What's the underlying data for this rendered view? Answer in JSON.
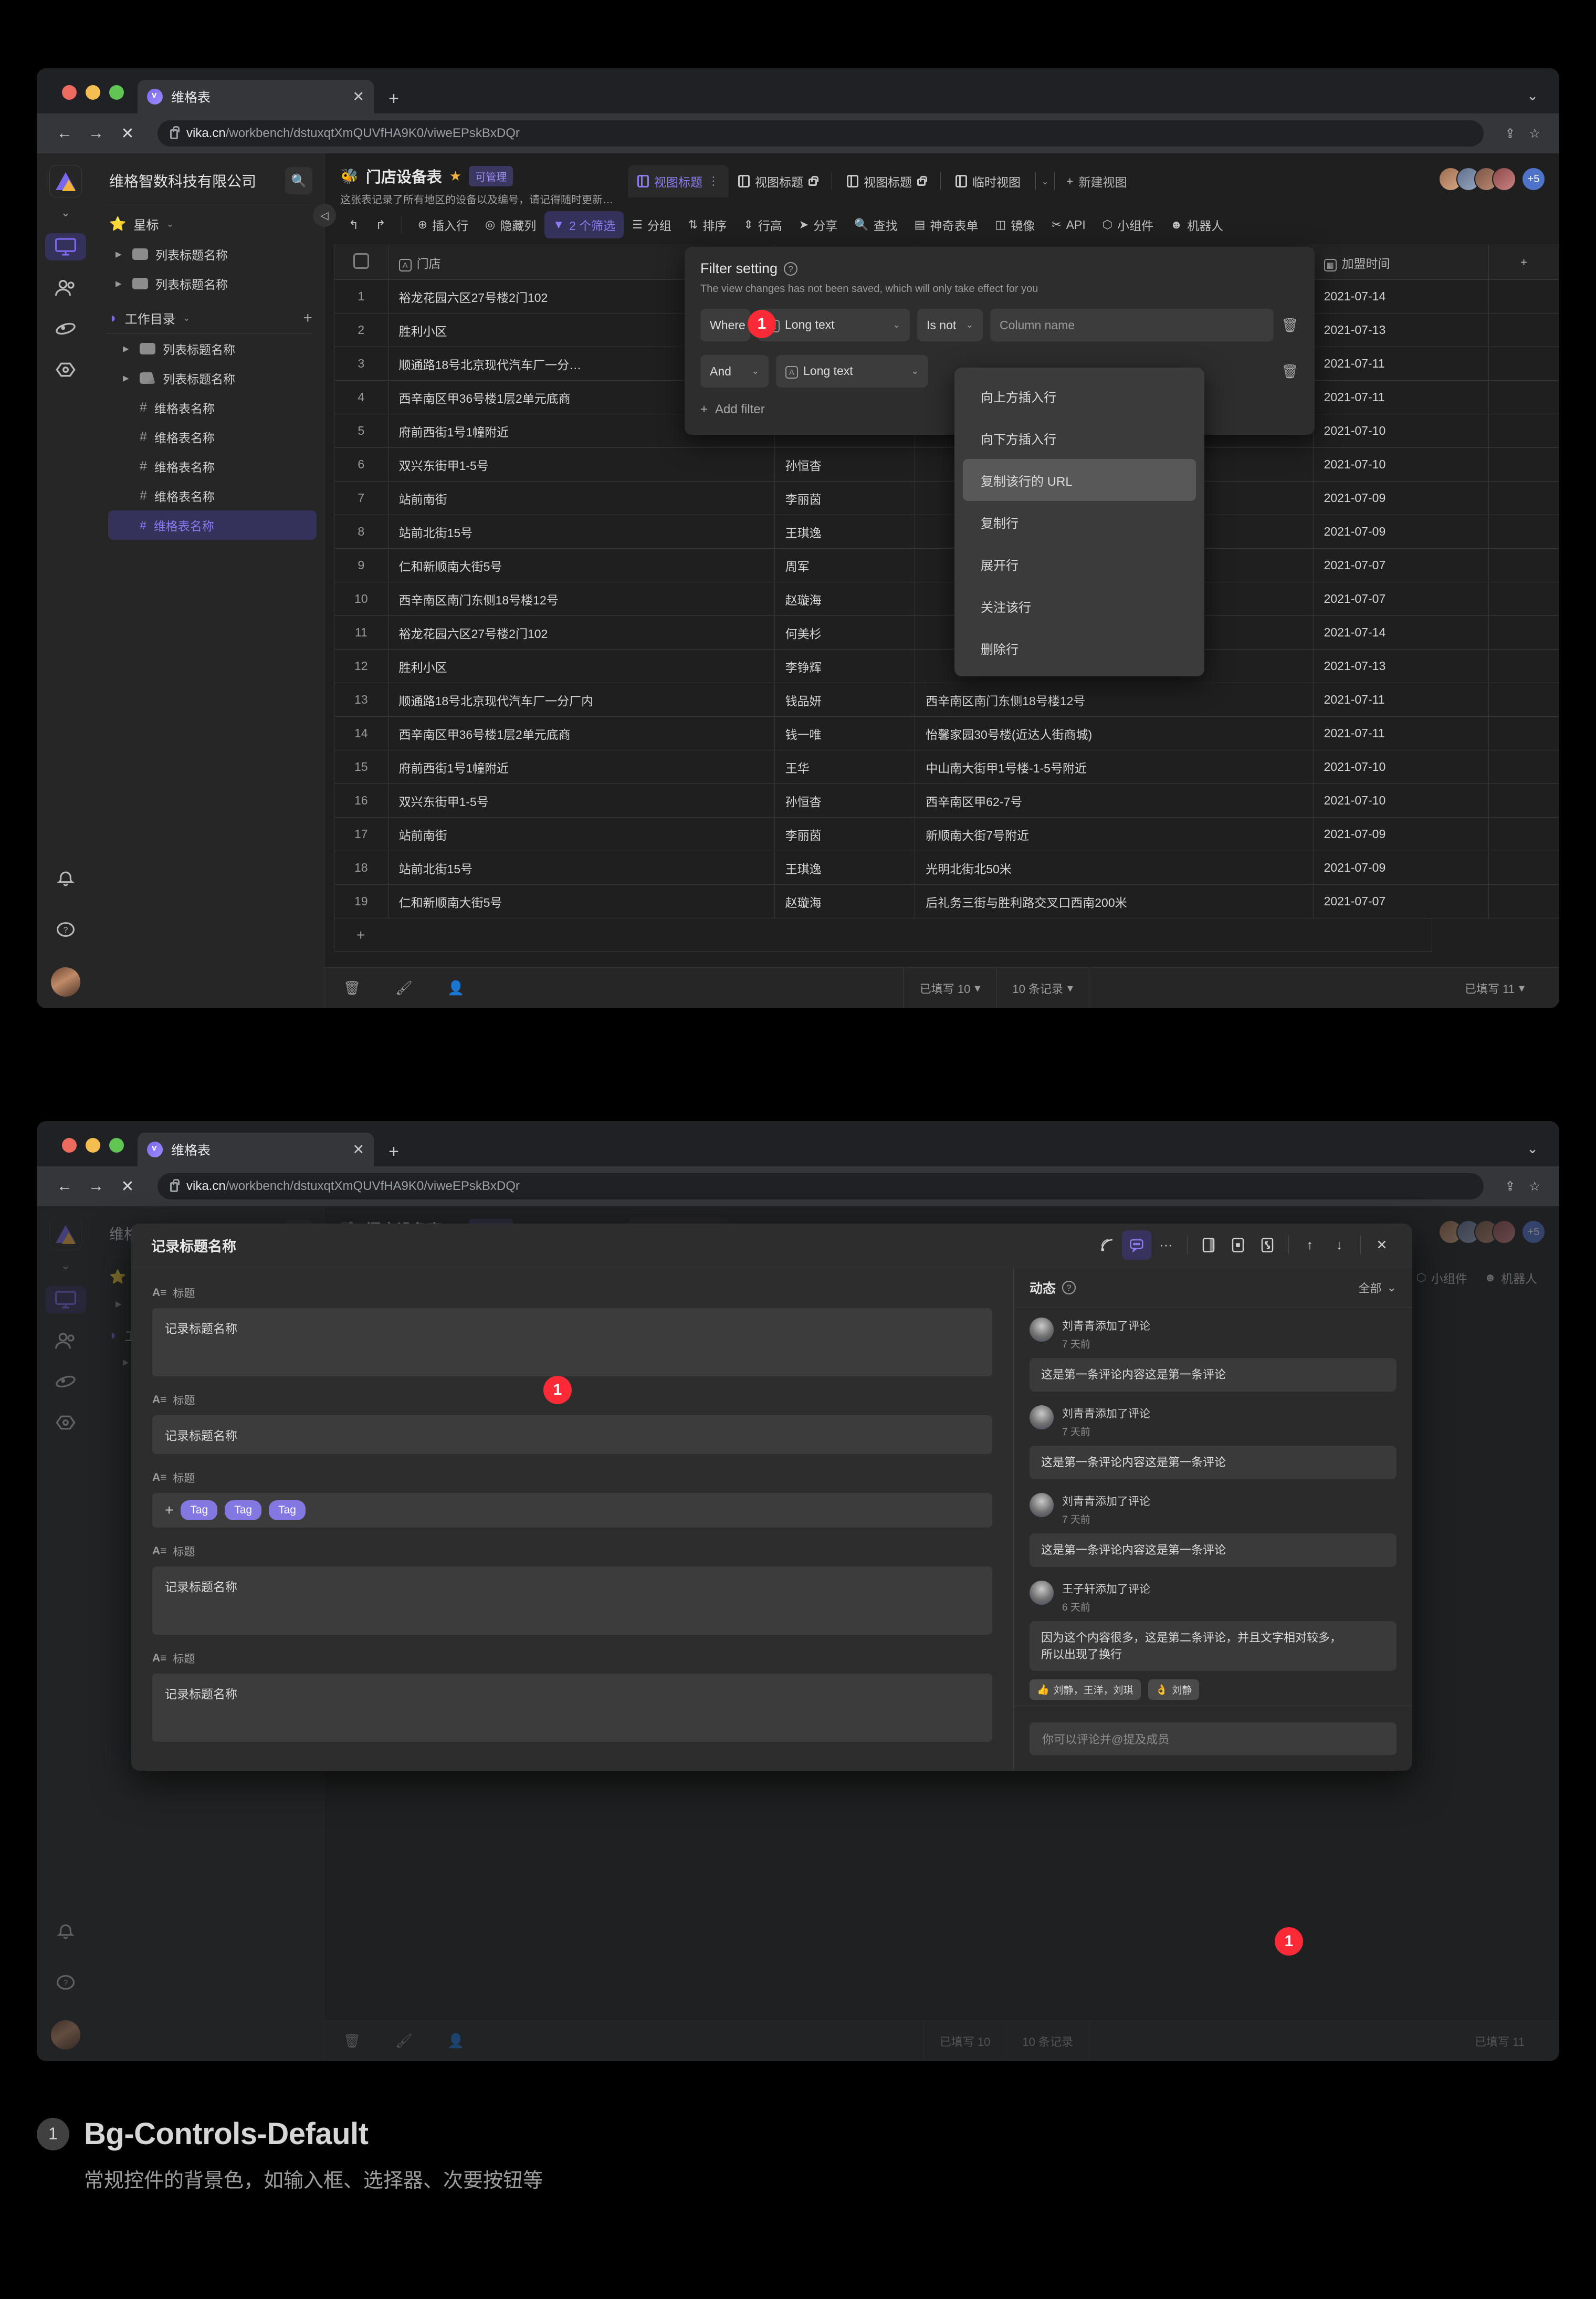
{
  "browser": {
    "tab_title": "维格表",
    "url_domain": "vika.cn",
    "url_path": "/workbench/dstuxqtXmQUVfHA9K0/viweEPskBxDQr",
    "close_label": "✕",
    "new_tab_label": "+",
    "back_label": "←",
    "forward_label": "→",
    "stop_label": "✕",
    "share_label": "⇪",
    "bookmark_label": "☆",
    "chevron_label": "⌄"
  },
  "rail": {
    "items": [
      {
        "name": "workbench",
        "glyph": "🖥",
        "active": true
      },
      {
        "name": "contacts",
        "glyph": "👥",
        "active": false
      },
      {
        "name": "template",
        "glyph": "🪐",
        "active": false
      },
      {
        "name": "settings",
        "glyph": "⬡",
        "active": false
      }
    ],
    "bottom": [
      {
        "name": "notification",
        "glyph": "🔔"
      },
      {
        "name": "help",
        "glyph": "?"
      }
    ]
  },
  "sidebar": {
    "org_name": "维格智数科技有限公司",
    "search_icon": "🔍",
    "star_group": {
      "label": "星标",
      "icon": "⭐",
      "chevron": "⌄"
    },
    "star_items": [
      "列表标题名称",
      "列表标题名称"
    ],
    "work_group": {
      "label": "工作目录",
      "icon": "📁",
      "chevron": "⌄",
      "add": "+"
    },
    "work_items": [
      "列表标题名称",
      "列表标题名称"
    ],
    "datasheets": [
      "维格表名称",
      "维格表名称",
      "维格表名称",
      "维格表名称"
    ],
    "selected_datasheet": "维格表名称"
  },
  "header": {
    "emoji": "🐝",
    "title": "门店设备表",
    "star": "★",
    "permission_badge": "可管理",
    "description": "这张表记录了所有地区的设备以及编号，请记得随时更新…",
    "views": [
      {
        "label": "视图标题",
        "active": true,
        "locked": false,
        "more": "⋮"
      },
      {
        "label": "视图标题",
        "active": false,
        "locked": true
      },
      {
        "label": "视图标题",
        "active": false,
        "locked": true
      },
      {
        "label": "临时视图",
        "active": false,
        "locked": false
      }
    ],
    "view_chevron": "⌄",
    "new_view": "新建视图",
    "collaborator_extra": "+5"
  },
  "toolbar": {
    "undo": "↰",
    "redo": "↱",
    "items": [
      {
        "label": "插入行",
        "glyph": "⊕",
        "highlight": false
      },
      {
        "label": "隐藏列",
        "glyph": "◎",
        "highlight": false
      },
      {
        "label": "2 个筛选",
        "glyph": "▼",
        "highlight": true
      },
      {
        "label": "分组",
        "glyph": "☰",
        "highlight": false
      },
      {
        "label": "排序",
        "glyph": "⇅",
        "highlight": false
      },
      {
        "label": "行高",
        "glyph": "⇕",
        "highlight": false
      },
      {
        "label": "分享",
        "glyph": "➤",
        "highlight": false
      },
      {
        "label": "查找",
        "glyph": "🔍",
        "highlight": false
      },
      {
        "label": "神奇表单",
        "glyph": "▤",
        "highlight": false
      },
      {
        "label": "镜像",
        "glyph": "◫",
        "highlight": false
      },
      {
        "label": "API",
        "glyph": "✂",
        "highlight": false
      },
      {
        "label": "小组件",
        "glyph": "⬡",
        "highlight": false
      },
      {
        "label": "机器人",
        "glyph": "☻",
        "highlight": false
      }
    ],
    "collapse_icon": "◁"
  },
  "grid": {
    "columns": [
      {
        "key": "check",
        "label": ""
      },
      {
        "key": "store",
        "label": "门店",
        "type_icon": "A"
      },
      {
        "key": "person",
        "label": ""
      },
      {
        "key": "address",
        "label": ""
      },
      {
        "key": "date",
        "label": "加盟时间",
        "type_icon": "▦"
      },
      {
        "key": "add",
        "label": "+"
      }
    ],
    "rows": [
      {
        "n": 1,
        "store": "裕龙花园六区27号楼2门102",
        "person": "",
        "address": "",
        "date": "2021-07-14"
      },
      {
        "n": 2,
        "store": "胜利小区",
        "person": "",
        "address": "",
        "date": "2021-07-13"
      },
      {
        "n": 3,
        "store": "顺通路18号北京现代汽车厂一分…",
        "person": "",
        "address": "",
        "date": "2021-07-11"
      },
      {
        "n": 4,
        "store": "西辛南区甲36号楼1层2单元底商",
        "person": "",
        "address": "",
        "date": "2021-07-11"
      },
      {
        "n": 5,
        "store": "府前西街1号1幢附近",
        "person": "",
        "address": "",
        "date": "2021-07-10"
      },
      {
        "n": 6,
        "store": "双兴东街甲1-5号",
        "person": "孙恒杳",
        "address": "",
        "date": "2021-07-10"
      },
      {
        "n": 7,
        "store": "站前南街",
        "person": "李丽茵",
        "address": "",
        "date": "2021-07-09"
      },
      {
        "n": 8,
        "store": "站前北街15号",
        "person": "王琪逸",
        "address": "",
        "date": "2021-07-09"
      },
      {
        "n": 9,
        "store": "仁和新顺南大街5号",
        "person": "周军",
        "address": "",
        "date": "2021-07-07"
      },
      {
        "n": 10,
        "store": "西辛南区南门东侧18号楼12号",
        "person": "赵璇海",
        "address": "",
        "date": "2021-07-07"
      },
      {
        "n": 11,
        "store": "裕龙花园六区27号楼2门102",
        "person": "何美杉",
        "address": "",
        "date": "2021-07-14"
      },
      {
        "n": 12,
        "store": "胜利小区",
        "person": "李铮辉",
        "address": "",
        "date": "2021-07-13"
      },
      {
        "n": 13,
        "store": "顺通路18号北京现代汽车厂一分厂内",
        "person": "钱品妍",
        "address": "西辛南区南门东侧18号楼12号",
        "date": "2021-07-11"
      },
      {
        "n": 14,
        "store": "西辛南区甲36号楼1层2单元底商",
        "person": "钱一唯",
        "address": "怡馨家园30号楼(近达人街商城)",
        "date": "2021-07-11"
      },
      {
        "n": 15,
        "store": "府前西街1号1幢附近",
        "person": "王华",
        "address": "中山南大街甲1号楼-1-5号附近",
        "date": "2021-07-10"
      },
      {
        "n": 16,
        "store": "双兴东街甲1-5号",
        "person": "孙恒杳",
        "address": "西辛南区甲62-7号",
        "date": "2021-07-10"
      },
      {
        "n": 17,
        "store": "站前南街",
        "person": "李丽茵",
        "address": "新顺南大街7号附近",
        "date": "2021-07-09"
      },
      {
        "n": 18,
        "store": "站前北街15号",
        "person": "王琪逸",
        "address": "光明北街北50米",
        "date": "2021-07-09"
      },
      {
        "n": 19,
        "store": "仁和新顺南大街5号",
        "person": "赵璇海",
        "address": "后礼务三街与胜利路交叉口西南200米",
        "date": "2021-07-07"
      }
    ],
    "add_row_label": "+"
  },
  "statusbar": {
    "trash_icon": "🗑",
    "brush_icon": "🖌",
    "person_icon": "👤",
    "cell_1": "已填写 10",
    "record_count": "10 条记录",
    "cell_2": "已填写 11",
    "caret": "▾"
  },
  "filter_popup": {
    "title": "Filter setting",
    "help": "?",
    "subtitle": "The view changes has not been saved, which will only take effect for you",
    "rows": [
      {
        "conj": "Where",
        "conj_has_chevron": false,
        "field": "Long text",
        "field_icon": "A",
        "operator": "Is not",
        "value": "Column name",
        "delete": "🗑"
      },
      {
        "conj": "And",
        "conj_has_chevron": true,
        "field": "Long text",
        "field_icon": "A",
        "operator": "",
        "value": "",
        "delete": "🗑"
      }
    ],
    "add_filter": "Add filter",
    "add_icon": "+"
  },
  "context_menu": {
    "items": [
      {
        "label": "向上方插入行",
        "highlight": false
      },
      {
        "label": "向下方插入行",
        "highlight": false
      },
      {
        "label": "复制该行的 URL",
        "highlight": true
      },
      {
        "label": "复制行",
        "highlight": false
      },
      {
        "label": "展开行",
        "highlight": false
      },
      {
        "label": "关注该行",
        "highlight": false
      },
      {
        "label": "删除行",
        "highlight": false
      }
    ]
  },
  "record_modal": {
    "title": "记录标题名称",
    "header_icons": [
      {
        "name": "subscribe-icon",
        "glyph": "))",
        "active": false
      },
      {
        "name": "comment-icon",
        "glyph": "💬",
        "active": true
      },
      {
        "name": "more-icon",
        "glyph": "···",
        "active": false
      },
      {
        "name": "layout-side-icon",
        "glyph": "▯",
        "active": false
      },
      {
        "name": "layout-center-icon",
        "glyph": "▣",
        "active": false
      },
      {
        "name": "expand-icon",
        "glyph": "⛶",
        "active": false
      },
      {
        "name": "prev-record-icon",
        "glyph": "↑",
        "active": false
      },
      {
        "name": "next-record-icon",
        "glyph": "↓",
        "active": false
      },
      {
        "name": "close-icon",
        "glyph": "✕",
        "active": false
      }
    ],
    "fields": [
      {
        "label": "标题",
        "icon": "A≡",
        "type": "textarea",
        "value": "记录标题名称"
      },
      {
        "label": "标题",
        "icon": "A≡",
        "type": "text",
        "value": "记录标题名称"
      },
      {
        "label": "标题",
        "icon": "A≡",
        "type": "tags",
        "value": "",
        "tags": [
          "Tag",
          "Tag",
          "Tag"
        ],
        "add": "+"
      },
      {
        "label": "标题",
        "icon": "A≡",
        "type": "textarea",
        "value": "记录标题名称"
      },
      {
        "label": "标题",
        "icon": "A≡",
        "type": "textarea",
        "value": "记录标题名称"
      }
    ],
    "activity": {
      "title": "动态",
      "help": "?",
      "filter_label": "全部",
      "filter_chevron": "⌄",
      "comments": [
        {
          "author": "刘青青添加了评论",
          "time": "7 天前",
          "body": "这是第一条评论内容这是第一条评论",
          "reactions": []
        },
        {
          "author": "刘青青添加了评论",
          "time": "7 天前",
          "body": "这是第一条评论内容这是第一条评论",
          "reactions": []
        },
        {
          "author": "刘青青添加了评论",
          "time": "7 天前",
          "body": "这是第一条评论内容这是第一条评论",
          "reactions": []
        },
        {
          "author": "王子轩添加了评论",
          "time": "6 天前",
          "body": "因为这个内容很多，这是第二条评论，并且文字相对较多，\n所以出现了换行",
          "reactions": [
            {
              "emoji": "👍",
              "names": "刘静，王洋，刘琪"
            },
            {
              "emoji": "👌",
              "names": "刘静"
            }
          ]
        }
      ],
      "input_placeholder": "你可以评论并@提及成员"
    }
  },
  "caption": {
    "number": "1",
    "title": "Bg-Controls-Default",
    "description": "常规控件的背景色，如输入框、选择器、次要按钮等"
  },
  "colors": {
    "accent": "#7b67ee",
    "marker": "#fa2b36",
    "control_bg": "#3c3c3c",
    "panel_bg": "#2d2d2d",
    "app_bg": "#1f1f1f"
  }
}
